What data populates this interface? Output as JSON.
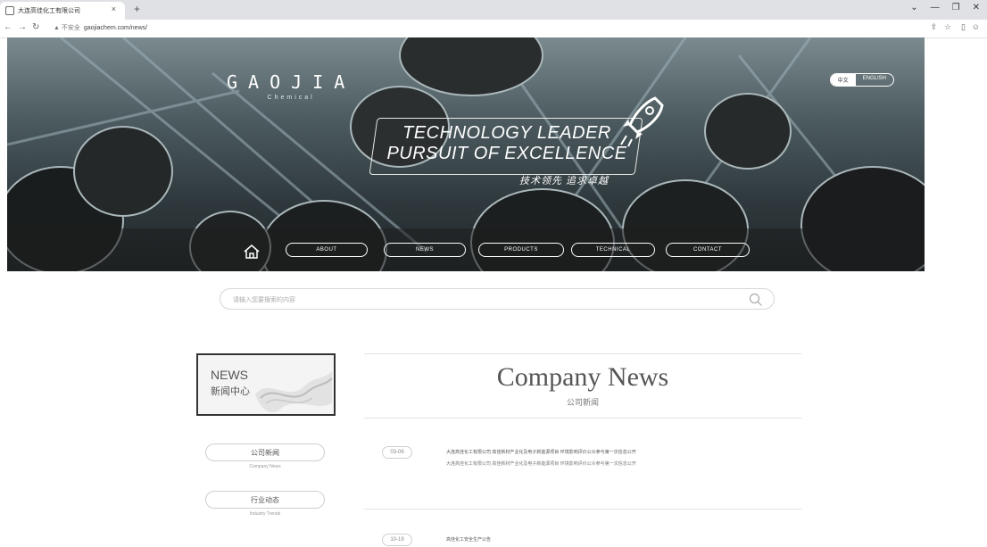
{
  "browser": {
    "tab_title": "大连高佳化工有限公司",
    "tab_close": "×",
    "tab_new": "+",
    "url_warning": "▲ 不安全",
    "url": "gaojiachem.com/news/",
    "window_buttons": [
      "⌄",
      "—",
      "❐",
      "✕"
    ]
  },
  "hero": {
    "brand": "GAOJIA",
    "brand_sub": "Chemical",
    "lang": [
      "中文",
      "ENGLISH"
    ],
    "slogan_line1": "TECHNOLOGY LEADER",
    "slogan_line2": "PURSUIT OF EXCELLENCE",
    "slogan_cn": "技术领先  追求卓越",
    "nav": [
      "ABOUT",
      "NEWS",
      "PRODUCTS",
      "TECHNICAL",
      "CONTACT"
    ]
  },
  "search": {
    "placeholder": "请输入您要搜索的内容"
  },
  "sidebar": {
    "box_en": "NEWS",
    "box_cn": "新闻中心",
    "items": [
      {
        "label": "公司新闻",
        "sub": "Company News"
      },
      {
        "label": "行业动态",
        "sub": "Industry Trends"
      }
    ]
  },
  "main": {
    "title": "Company News",
    "subtitle": "公司新闻",
    "news": [
      {
        "date": "03-06",
        "line1": "大连高佳化工有限公司 高佳新材产业化及电子新能源项目 环境影响评价公众参与第一次信息公开",
        "line2": "大连高佳化工有限公司 高佳新材产业化及电子新能源项目 环境影响评价公众参与第一次信息公开"
      },
      {
        "date": "10-19",
        "line1": "高佳化工安全生产公告"
      }
    ]
  },
  "colors": {
    "hero_dark": "#1f2629",
    "accent": "#ffffff"
  }
}
